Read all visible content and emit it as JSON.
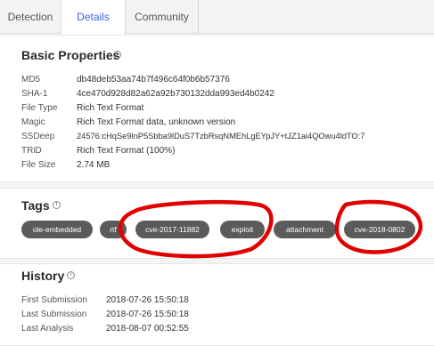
{
  "tabs": [
    {
      "label": "Detection"
    },
    {
      "label": "Details"
    },
    {
      "label": "Community"
    }
  ],
  "basic": {
    "title": "Basic Properties",
    "rows": [
      {
        "key": "MD5",
        "value": "db48deb53aa74b7f496c64f0b6b57376"
      },
      {
        "key": "SHA-1",
        "value": "4ce470d928d82a62a92b730132dda993ed4b0242"
      },
      {
        "key": "File Type",
        "value": "Rich Text Format"
      },
      {
        "key": "Magic",
        "value": "Rich Text Format data, unknown version"
      },
      {
        "key": "SSDeep",
        "value": "24576:cHqSe9lnP5Sbba9lDuS7TzbRsqNMEhLgEYpJY+tJZ1ai4QOwu4ldTO:7"
      },
      {
        "key": "TRiD",
        "value": "Rich Text Format (100%)"
      },
      {
        "key": "File Size",
        "value": "2.74 MB"
      }
    ]
  },
  "tags": {
    "title": "Tags",
    "items": [
      {
        "label": "ole-embedded"
      },
      {
        "label": "rtf"
      },
      {
        "label": "cve-2017-11882"
      },
      {
        "label": "exploit"
      },
      {
        "label": "attachment"
      },
      {
        "label": "cve-2018-0802"
      }
    ]
  },
  "history": {
    "title": "History",
    "rows": [
      {
        "key": "First Submission",
        "value": "2018-07-26 15:50:18"
      },
      {
        "key": "Last Submission",
        "value": "2018-07-26 15:50:18"
      },
      {
        "key": "Last Analysis",
        "value": "2018-08-07 00:52:55"
      }
    ]
  },
  "colors": {
    "active_tab": "#3d64e6",
    "tag_bg": "#5b5b5b",
    "annotation": "#e00000"
  },
  "icons": {
    "section_info": "info-icon"
  }
}
